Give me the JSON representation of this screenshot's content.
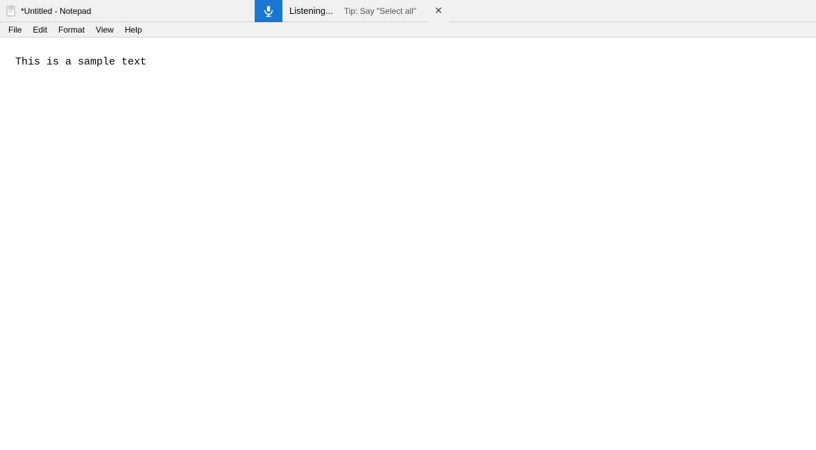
{
  "titleBar": {
    "title": "*Untitled - Notepad",
    "iconAlt": "notepad-icon"
  },
  "menuBar": {
    "items": [
      "File",
      "Edit",
      "Format",
      "View",
      "Help"
    ]
  },
  "dictation": {
    "micIcon": "🎤",
    "listeningLabel": "Listening...",
    "tipLabel": "Tip: Say \"Select all\"",
    "closeIcon": "✕"
  },
  "editor": {
    "content": "This is a sample text"
  }
}
